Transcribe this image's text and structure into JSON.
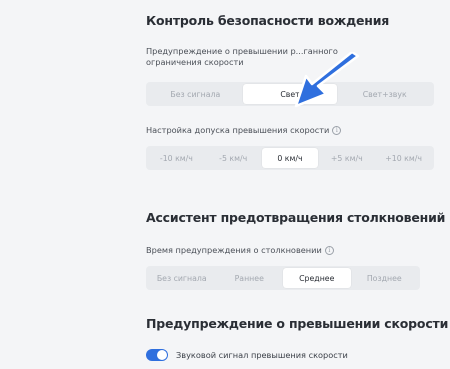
{
  "driving_safety": {
    "title": "Контроль безопасности вождения",
    "speed_limit_warning": {
      "label_line1": "Предупреждение о превышении р...ганного",
      "label_line2": "ограничения скорости",
      "options": [
        "Без сигнала",
        "Свет",
        "Свет+звук"
      ],
      "selected": "Свет"
    },
    "tolerance": {
      "label": "Настройка допуска превышения скорости",
      "options": [
        "-10 км/ч",
        "-5 км/ч",
        "0 км/ч",
        "+5 км/ч",
        "+10 км/ч"
      ],
      "selected": "0 км/ч"
    }
  },
  "collision_assist": {
    "title": "Ассистент предотвращения столкновений",
    "warning_time": {
      "label": "Время предупреждения о столкновении",
      "options": [
        "Без сигнала",
        "Раннее",
        "Среднее",
        "Позднее"
      ],
      "selected": "Среднее"
    }
  },
  "speed_warning": {
    "title": "Предупреждение о превышении скорости",
    "sound_toggle": {
      "label": "Звуковой сигнал превышения скорости",
      "enabled": true
    }
  },
  "icons": {
    "info": "info-icon",
    "pointer": "arrow-pointer-icon"
  },
  "colors": {
    "accent": "#2f6fde",
    "arrow": "#2f6fde"
  }
}
